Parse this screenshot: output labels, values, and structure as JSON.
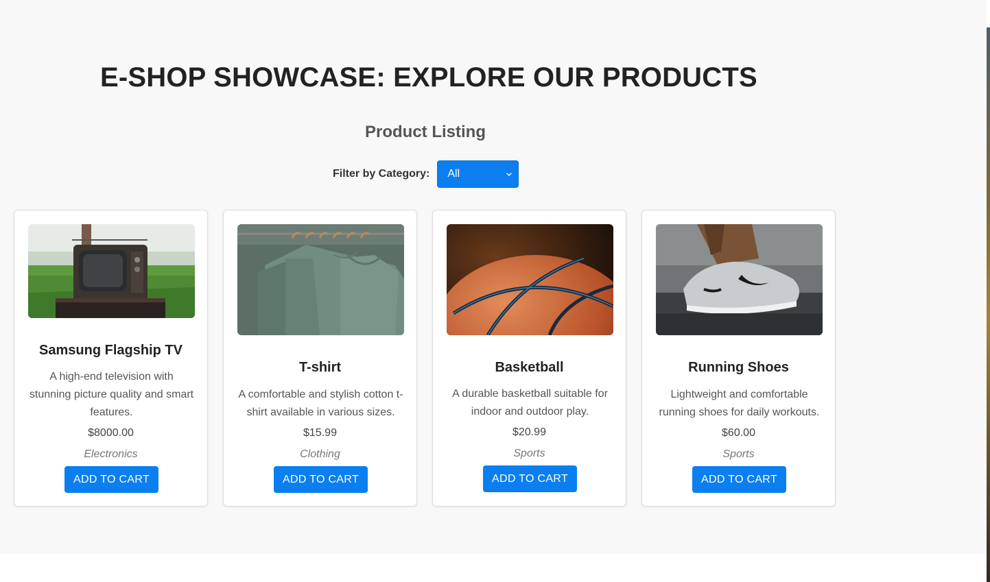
{
  "page": {
    "heading": "E-SHOP SHOWCASE: EXPLORE OUR PRODUCTS",
    "subheading": "Product Listing"
  },
  "filter": {
    "label": "Filter by Category:",
    "selected": "All"
  },
  "products": [
    {
      "name": "Samsung Flagship TV",
      "description": "A high-end television with stunning picture quality and smart features.",
      "price": "$8000.00",
      "category": "Electronics",
      "button": "ADD TO CART",
      "image": "vintage-tv-photo"
    },
    {
      "name": "T-shirt",
      "description": "A comfortable and stylish cotton t-shirt available in various sizes.",
      "price": "$15.99",
      "category": "Clothing",
      "button": "ADD TO CART",
      "image": "tshirts-on-hangers-photo"
    },
    {
      "name": "Basketball",
      "description": "A durable basketball suitable for indoor and outdoor play.",
      "price": "$20.99",
      "category": "Sports",
      "button": "ADD TO CART",
      "image": "basketball-photo"
    },
    {
      "name": "Running Shoes",
      "description": "Lightweight and comfortable running shoes for daily workouts.",
      "price": "$60.00",
      "category": "Sports",
      "button": "ADD TO CART",
      "image": "running-shoe-photo"
    }
  ],
  "colors": {
    "accent": "#0b7ff0",
    "page_background": "#f8f8f9",
    "card_background": "#ffffff"
  }
}
